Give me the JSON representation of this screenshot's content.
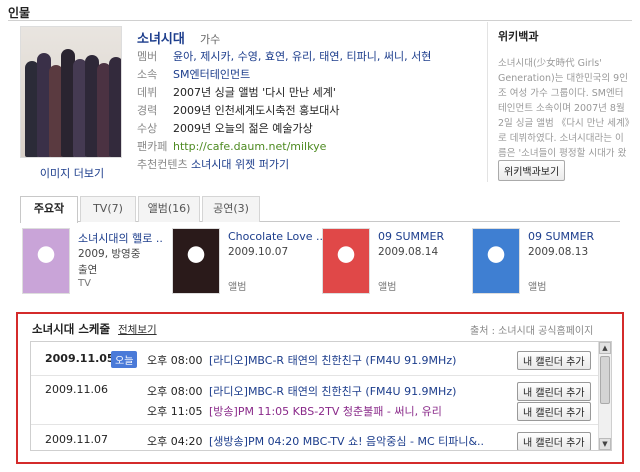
{
  "section_title": "인물",
  "person": {
    "name": "소녀시대",
    "role": "가수",
    "more_images": "이미지 더보기",
    "info": [
      {
        "k": "멤버",
        "v": "윤아, 제시카, 수영, 효연, 유리, 태연, 티파니, 써니, 서현",
        "style": "link"
      },
      {
        "k": "소속",
        "v": "SM엔터테인먼트",
        "style": "link"
      },
      {
        "k": "데뷔",
        "v": "2007년 싱글 앨범 '다시 만난 세계'",
        "style": ""
      },
      {
        "k": "경력",
        "v": "2009년 인천세계도시축전 홍보대사",
        "style": ""
      },
      {
        "k": "수상",
        "v": "2009년 오늘의 젊은 예술가상",
        "style": ""
      },
      {
        "k": "팬카페",
        "v": "http://cafe.daum.net/milkye",
        "style": "url"
      },
      {
        "k": "추천컨텐츠",
        "v": "소녀시대 위젯 퍼가기",
        "style": "link"
      }
    ]
  },
  "wiki": {
    "title": "위키백과",
    "text": "소녀시대(少女時代 Girls' Generation)는 대한민국의 9인조 여성 가수 그룹이다. SM엔터테인먼트 소속이며 2007년 8월 2일 싱글 앨범 《다시 만난 세계》로 데뷔하였다. 소녀시대라는 이름은 '소녀들이 평정할 시대가 왔다'는 의미다.",
    "button": "위키백과보기"
  },
  "tabs": [
    {
      "label": "주요작",
      "active": true
    },
    {
      "label": "TV(7)",
      "active": false
    },
    {
      "label": "앨범(16)",
      "active": false
    },
    {
      "label": "공연(3)",
      "active": false
    }
  ],
  "works": [
    {
      "title": "소녀시대의 헬로 ..",
      "line1": "2009, 방영중",
      "line2": "출연",
      "tag": "TV",
      "color": "#c9a4d8"
    },
    {
      "title": "Chocolate Love ..",
      "line1": "2009.10.07",
      "line2": "",
      "tag": "앨범",
      "color": "#2a1a1a"
    },
    {
      "title": "09 SUMMER",
      "line1": "2009.08.14",
      "line2": "",
      "tag": "앨범",
      "color": "#e04848"
    },
    {
      "title": "09 SUMMER",
      "line1": "2009.08.13",
      "line2": "",
      "tag": "앨범",
      "color": "#3f7fd2"
    }
  ],
  "schedule": {
    "title": "소녀시대 스케줄",
    "all_link": "전체보기",
    "source": "출처 : 소녀시대 공식홈페이지",
    "today_badge": "오늘",
    "add_label": "내 캘린더 추가",
    "rows": [
      {
        "date": "2009.11.05",
        "time": "오후 08:00",
        "desc": "[라디오]MBC-R 태연의 친한친구 (FM4U 91.9MHz)",
        "purple": false
      },
      {
        "date": "2009.11.06",
        "time": "오후 08:00",
        "desc": "[라디오]MBC-R 태연의 친한친구 (FM4U 91.9MHz)",
        "purple": false
      },
      {
        "date": "",
        "time": "오후 11:05",
        "desc": "[방송]PM 11:05 KBS-2TV 청춘불패 - 써니, 유리",
        "purple": true
      },
      {
        "date": "2009.11.07",
        "time": "오후 04:20",
        "desc": "[생방송]PM 04:20 MBC-TV 쇼! 음악중심 - MC 티파니&..",
        "purple": false
      }
    ]
  }
}
